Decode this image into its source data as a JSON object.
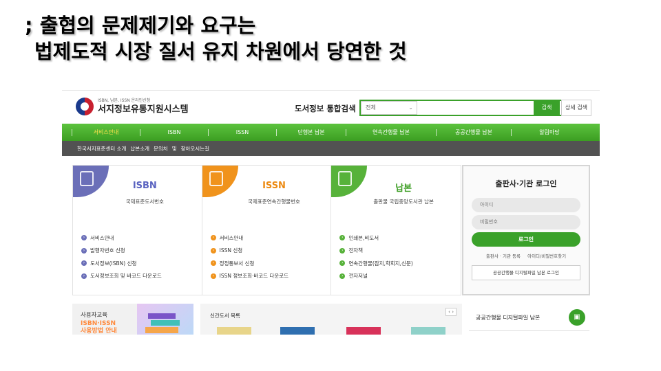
{
  "slide": {
    "line1": "; 출협의 문제제기와 요구는",
    "line2": "법제도적 시장 질서 유지 차원에서 당연한 것"
  },
  "site": {
    "logo_small": "ISBN, 납본, ISSN 온라인신청",
    "logo_big": "서지정보유통지원시스템",
    "search_title": "도서정보 통합검색",
    "search_scope": "전체",
    "search_button": "검색",
    "detail_search": "상세 검색"
  },
  "gnb": [
    "서비스안내",
    "ISBN",
    "ISSN",
    "단행본 납본",
    "연속간행물 납본",
    "공공간행물 납본",
    "알림마당"
  ],
  "subnav": [
    "한국서지표준센터 소개",
    "납본소개",
    "문의처",
    "및",
    "찾아오시는길"
  ],
  "cards": [
    {
      "title": "ISBN",
      "subtitle": "국제표준도서번호",
      "color": "#6b6fb8",
      "links": [
        "서비스안내",
        "발행자번호 신청",
        "도서정보(ISBN) 신청",
        "도서정보조회 및 바코드 다운로드"
      ]
    },
    {
      "title": "ISSN",
      "subtitle": "국제표준연속간행물번호",
      "color": "#f0931c",
      "links": [
        "서비스안내",
        "ISSN 신청",
        "정정통보서 신청",
        "ISSN 정보조회·바코드 다운로드"
      ]
    },
    {
      "title": "납본",
      "subtitle": "출판물 국립중앙도서관 납본",
      "color": "#57b23a",
      "links": [
        "인쇄본,비도서",
        "전자책",
        "연속간행물(잡지,학회지,신문)",
        "전자저널"
      ]
    }
  ],
  "login": {
    "title": "출판사·기관 로그인",
    "id_placeholder": "아이디",
    "pw_placeholder": "비밀번호",
    "button": "로그인",
    "register": "출판사 · 기관 등록",
    "find": "아이디/비밀번호찾기",
    "gov_login": "공공간행물 디지털파일 납본 로그인"
  },
  "bottom": {
    "edu_title": "사용자교육",
    "edu_sub1": "ISBN·ISSN",
    "edu_sub2": "사용방법 안내",
    "newbooks_title": "신간도서 목록",
    "pager": "‹  ›",
    "digital_title": "공공간행물 디지털파일 납본"
  },
  "icons": {
    "logo": "taegeuk-logo-icon",
    "arrow": "circle-arrow-icon",
    "digital": "document-icon"
  }
}
